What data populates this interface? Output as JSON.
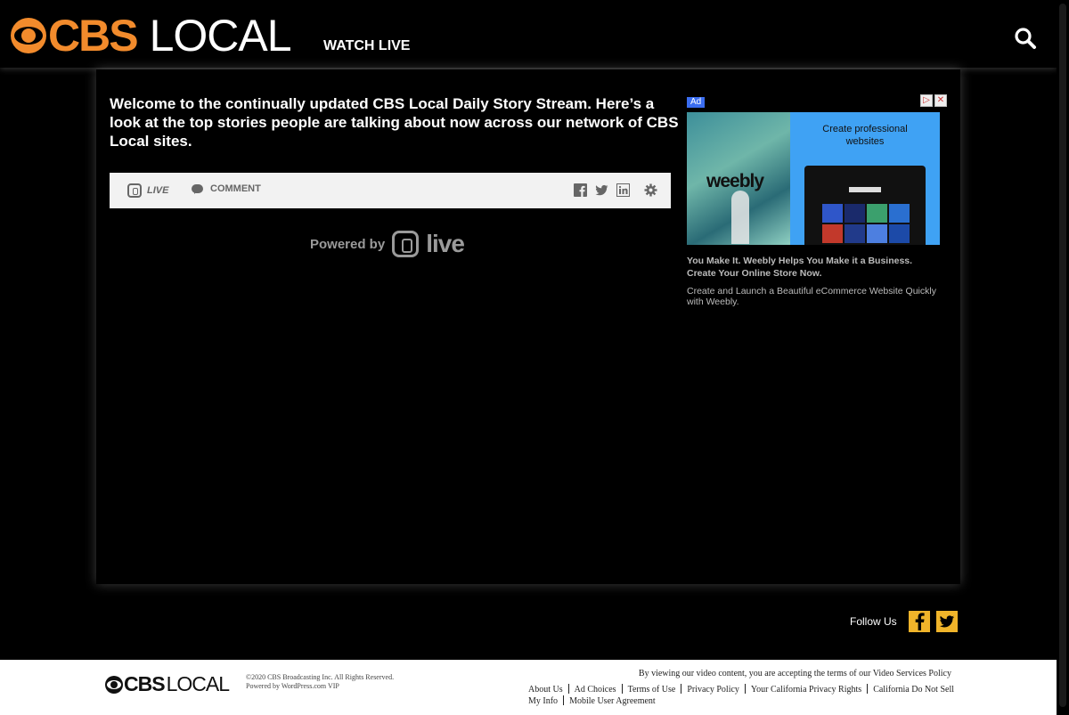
{
  "header": {
    "logo_cbs": "CBS",
    "logo_local": "LOCAL",
    "watch_live": "WATCH LIVE"
  },
  "main": {
    "intro": "Welcome to the continually updated CBS Local Daily Story Stream. Here’s a look at the top stories people are talking about now across our network of CBS Local sites.",
    "live_label": "LIVE",
    "comment_label": "COMMENT",
    "powered_by": "Powered by",
    "powered_brand": "live"
  },
  "ad": {
    "label": "Ad",
    "brand": "weebly",
    "headline": "Create professional websites",
    "title": "You Make It. Weebly Helps You Make it a Business. Create Your Online Store Now.",
    "description": "Create and Launch a Beautiful eCommerce Website Quickly with Weebly."
  },
  "follow": {
    "label": "Follow Us"
  },
  "footer": {
    "logo_cbs": "CBS",
    "logo_local": "LOCAL",
    "copyright": "©2020 CBS Broadcasting Inc. All Rights Reserved.",
    "powered": "Powered by WordPress.com VIP",
    "policy": "By viewing our video content, you are accepting the terms of our Video Services Policy",
    "links": [
      "About Us",
      "Ad Choices",
      "Terms of Use",
      "Privacy Policy",
      "Your California Privacy Rights",
      "California Do Not Sell My Info",
      "Mobile User Agreement"
    ]
  },
  "colors": {
    "brand_orange": "#f28b2c",
    "social_yellow": "#f0b42a",
    "ad_blue": "#3fa2f4"
  },
  "icons": [
    "search-icon",
    "live-icon",
    "comment-icon",
    "facebook-icon",
    "twitter-icon",
    "linkedin-icon",
    "gear-icon",
    "facebook-icon",
    "twitter-icon"
  ]
}
